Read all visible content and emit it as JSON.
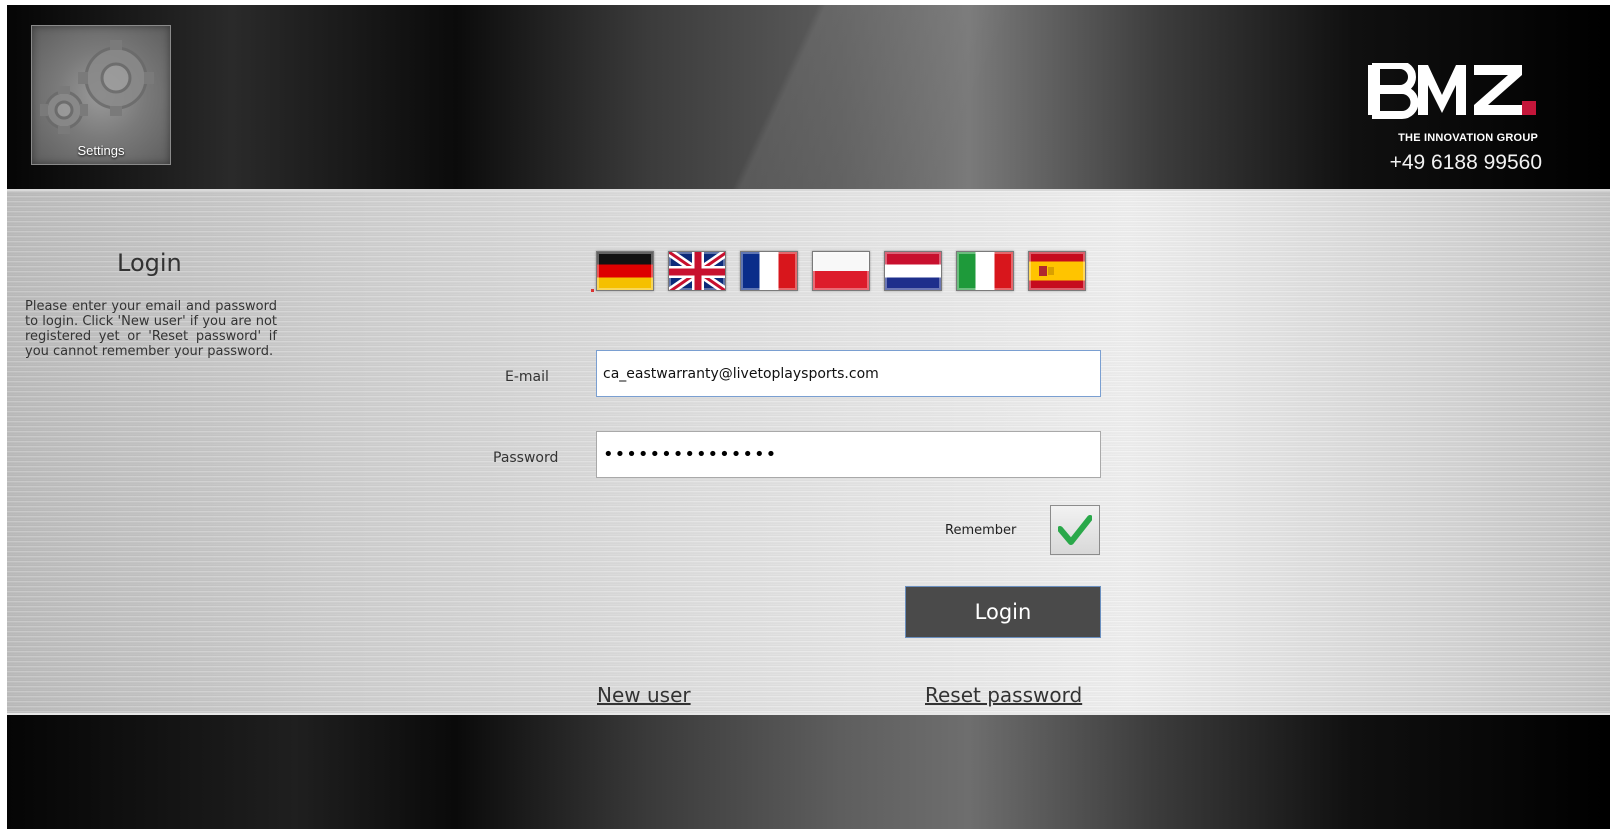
{
  "header": {
    "settings_label": "Settings",
    "logo_text": "BMZ",
    "logo_subtitle": "THE INNOVATION GROUP",
    "phone": "+49 6188 99560"
  },
  "login": {
    "title": "Login",
    "description": "Please enter your email and password to login. Click 'New user' if you are not registered yet or 'Reset password' if you cannot remember your password.",
    "languages": [
      {
        "code": "de",
        "flag": "germany-flag"
      },
      {
        "code": "en",
        "flag": "uk-flag"
      },
      {
        "code": "fr",
        "flag": "france-flag"
      },
      {
        "code": "pl",
        "flag": "poland-flag"
      },
      {
        "code": "nl",
        "flag": "netherlands-flag"
      },
      {
        "code": "it",
        "flag": "italy-flag"
      },
      {
        "code": "es",
        "flag": "spain-flag"
      }
    ],
    "email_label": "E-mail",
    "email_value": "ca_eastwarranty@livetoplaysports.com",
    "password_label": "Password",
    "password_masked": "•••••••••••••••",
    "remember_label": "Remember",
    "remember_checked": true,
    "login_button": "Login",
    "new_user_link": "New user",
    "reset_password_link": "Reset password"
  },
  "colors": {
    "accent_red": "#c4163a",
    "check_green": "#2aa84a",
    "button_bg": "#4a4a4a"
  }
}
